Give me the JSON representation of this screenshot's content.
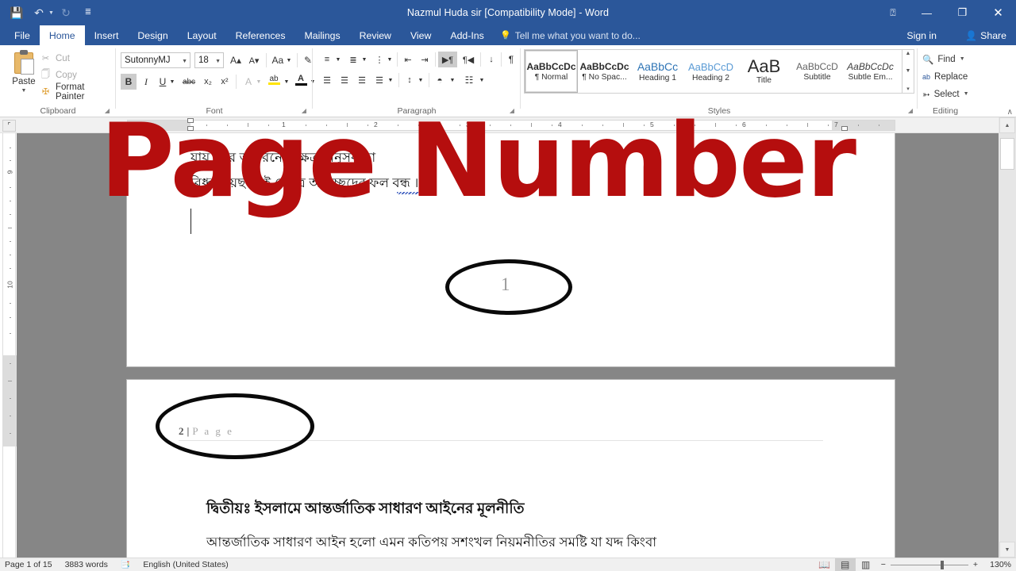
{
  "window": {
    "title": "Nazmul Huda sir [Compatibility Mode] - Word",
    "quick_access": [
      {
        "name": "save",
        "glyph": "💾"
      },
      {
        "name": "undo",
        "glyph": "↶"
      },
      {
        "name": "redo",
        "glyph": "↻"
      },
      {
        "name": "customize-qat",
        "glyph": "☰"
      }
    ],
    "controls": {
      "ribbon_display_options": "❐",
      "minimize": "—",
      "restore": "❐",
      "close": "✕"
    }
  },
  "tabs": [
    {
      "label": "File",
      "active": false
    },
    {
      "label": "Home",
      "active": true
    },
    {
      "label": "Insert",
      "active": false
    },
    {
      "label": "Design",
      "active": false
    },
    {
      "label": "Layout",
      "active": false
    },
    {
      "label": "References",
      "active": false
    },
    {
      "label": "Mailings",
      "active": false
    },
    {
      "label": "Review",
      "active": false
    },
    {
      "label": "View",
      "active": false
    },
    {
      "label": "Add-Ins",
      "active": false
    }
  ],
  "tellme": {
    "placeholder": "Tell me what you want to do...",
    "icon": "💡"
  },
  "account": {
    "sign_in": "Sign in",
    "share": "Share",
    "share_icon": "person-plus-icon"
  },
  "ribbon": {
    "clipboard": {
      "group_label": "Clipboard",
      "paste_label": "Paste",
      "items": [
        {
          "label": "Cut",
          "icon": "scissors-icon",
          "enabled": false
        },
        {
          "label": "Copy",
          "icon": "copy-icon",
          "enabled": false
        },
        {
          "label": "Format Painter",
          "icon": "paintbrush-icon",
          "enabled": true
        }
      ]
    },
    "font": {
      "group_label": "Font",
      "font_name": "SutonnyMJ",
      "font_size": "18",
      "grow_font": "A▴",
      "shrink_font": "A▾",
      "change_case": "Aa",
      "clear_formatting": "clear-formatting-icon",
      "bold": "B",
      "italic": "I",
      "underline": "U",
      "strikethrough": "abc",
      "subscript": "x₂",
      "superscript": "x²",
      "text_effects": "A",
      "highlight": "ab",
      "font_color": "A",
      "bold_active": true
    },
    "paragraph": {
      "group_label": "Paragraph",
      "buttons": [
        "bullets",
        "numbering",
        "multilevel-list",
        "decrease-indent",
        "increase-indent",
        "ltr-text-direction",
        "rtl-text-direction",
        "sort",
        "show-formatting-marks",
        "align-left",
        "align-center",
        "align-right",
        "justify",
        "line-spacing",
        "shading",
        "borders"
      ],
      "active_button": "ltr-text-direction"
    },
    "styles": {
      "group_label": "Styles",
      "items": [
        {
          "sample": "AaBbCcDc",
          "name": "¶ Normal",
          "selected": true
        },
        {
          "sample": "AaBbCcDc",
          "name": "¶ No Spac...",
          "selected": false
        },
        {
          "sample": "AaBbCc",
          "name": "Heading 1",
          "selected": false
        },
        {
          "sample": "AaBbCcD",
          "name": "Heading 2",
          "selected": false
        },
        {
          "sample": "AaB",
          "name": "Title",
          "selected": false
        },
        {
          "sample": "AaBbCcD",
          "name": "Subtitle",
          "selected": false
        },
        {
          "sample": "AaBbCcDc",
          "name": "Subtle Em...",
          "selected": false
        }
      ]
    },
    "editing": {
      "group_label": "Editing",
      "items": [
        {
          "label": "Find",
          "icon": "search-icon",
          "has_caret": true
        },
        {
          "label": "Replace",
          "icon": "replace-icon",
          "has_caret": false
        },
        {
          "label": "Select",
          "icon": "cursor-icon",
          "has_caret": true
        }
      ],
      "collapse_ribbon": "∧"
    }
  },
  "ruler": {
    "horizontal_marks": [
      "1",
      "2",
      "3",
      "4",
      "5",
      "6",
      "7"
    ],
    "vertical_marks": [
      "9",
      "10"
    ]
  },
  "document": {
    "page1": {
      "line1": "যায় । দর আচরনের ক্ষেত্র অনুসর্ব তা",
      "line2": "বিধ্ব হয়েছ। এই ক্ষেত্রে অনুচ্ছেদের ফল বন্ধ ।",
      "page_number": "1"
    },
    "page2": {
      "header_number": "2",
      "header_separator": "|",
      "header_label": "P a g e",
      "heading": "দ্বিতীয়ঃ ইসলামে আন্তর্জাতিক সাধারণ আইনের মূলনীতি",
      "body": "আন্তর্জাতিক সাধারণ আইন হলো   এমন কতিপয় সশংখল নিয়মনীতির সমষ্টি যা যদ্দ কিংবা"
    }
  },
  "overlay": {
    "text": "Page Number",
    "color": "#b50e0e"
  },
  "status_bar": {
    "page_info": "Page 1 of 15",
    "word_count": "3883 words",
    "proofing_icon": "proofing-errors-icon",
    "language": "English (United States)",
    "views": [
      {
        "name": "read-mode",
        "glyph": "📖",
        "active": false
      },
      {
        "name": "print-layout",
        "glyph": "▤",
        "active": true
      },
      {
        "name": "web-layout",
        "glyph": "▥",
        "active": false
      }
    ],
    "zoom_out": "−",
    "zoom_in": "+",
    "zoom_level": "130%"
  }
}
